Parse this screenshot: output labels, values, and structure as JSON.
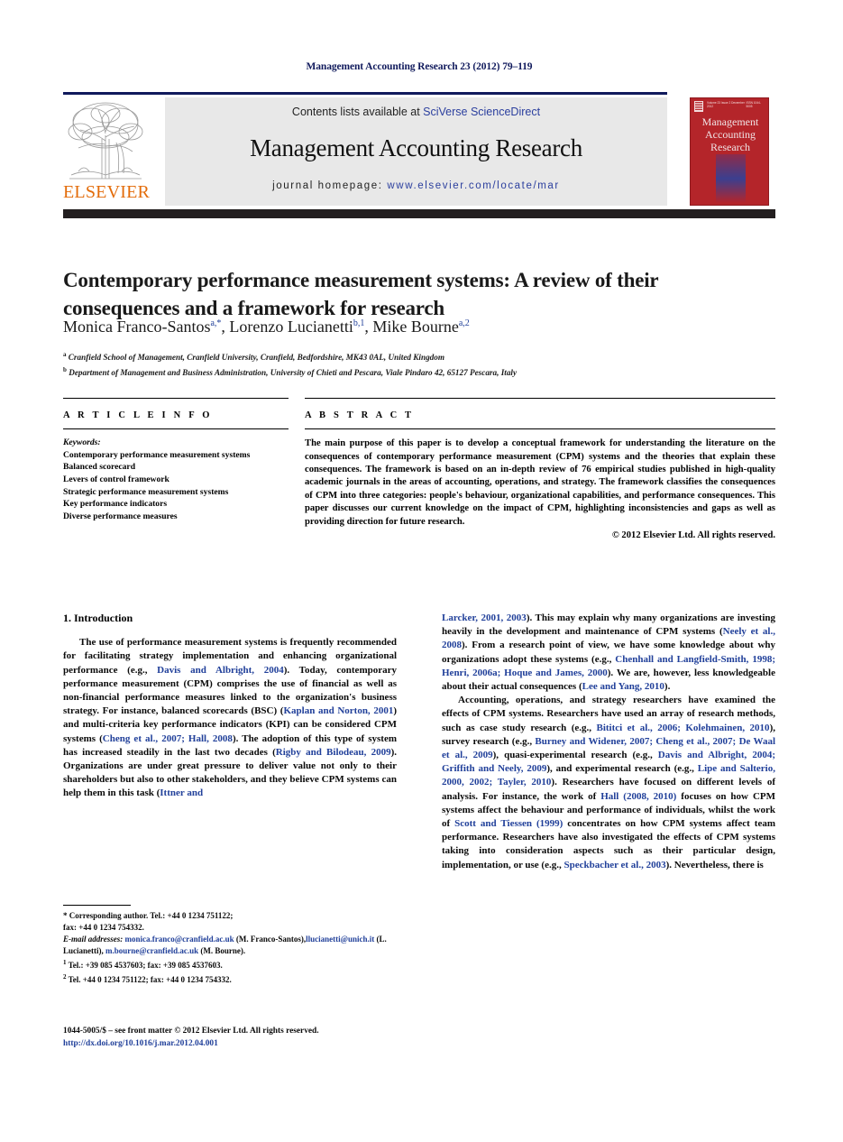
{
  "running_head": "Management Accounting Research 23 (2012) 79–119",
  "masthead": {
    "contents_prefix": "Contents lists available at ",
    "sciencedirect": "SciVerse ScienceDirect",
    "journal_title": "Management Accounting Research",
    "homepage_prefix": "journal homepage: ",
    "homepage_url": "www.elsevier.com/locate/mar",
    "publisher_logo_text": "ELSEVIER",
    "logo_icon": "elsevier-tree-icon",
    "accent_blue": "#2b3f9e",
    "logo_orange": "#e36c0a",
    "band_color": "#231f20"
  },
  "cover": {
    "title_line1": "Management",
    "title_line2": "Accounting",
    "title_line3": "Research",
    "meta_left": "Volume 23 Issue 2 December 2012",
    "meta_right": "ISSN 1044-5005",
    "color": "#b4252a"
  },
  "article": {
    "title": "Contemporary performance measurement systems: A review of their consequences and a framework for research",
    "authors": [
      {
        "name": "Monica Franco-Santos",
        "marks": "a,*"
      },
      {
        "name": "Lorenzo Lucianetti",
        "marks": "b,1"
      },
      {
        "name": "Mike Bourne",
        "marks": "a,2"
      }
    ],
    "affiliations": [
      {
        "mark": "a",
        "text": "Cranfield School of Management, Cranfield University, Cranfield, Bedfordshire, MK43 0AL, United Kingdom"
      },
      {
        "mark": "b",
        "text": "Department of Management and Business Administration, University of Chieti and Pescara, Viale Pindaro 42, 65127 Pescara, Italy"
      }
    ]
  },
  "article_info": {
    "heading": "A R T I C L E    I N F O",
    "keywords_label": "Keywords:",
    "keywords": [
      "Contemporary performance measurement systems",
      "Balanced scorecard",
      "Levers of control framework",
      "Strategic performance measurement systems",
      "Key performance indicators",
      "Diverse performance measures"
    ]
  },
  "abstract": {
    "heading": "A B S T R A C T",
    "text": "The main purpose of this paper is to develop a conceptual framework for understanding the literature on the consequences of contemporary performance measurement (CPM) systems and the theories that explain these consequences. The framework is based on an in-depth review of 76 empirical studies published in high-quality academic journals in the areas of accounting, operations, and strategy. The framework classifies the consequences of CPM into three categories: people's behaviour, organizational capabilities, and performance consequences. This paper discusses our current knowledge on the impact of CPM, highlighting inconsistencies and gaps as well as providing direction for future research.",
    "copyright": "© 2012 Elsevier Ltd. All rights reserved."
  },
  "body": {
    "section_heading": "1.  Introduction",
    "left_paragraphs": [
      {
        "parts": [
          {
            "t": "The use of performance measurement systems is frequently recommended for facilitating strategy implementation and enhancing organizational performance (e.g., "
          },
          {
            "t": "Davis and Albright, 2004",
            "ref": true
          },
          {
            "t": "). Today, contemporary performance measurement (CPM) comprises the use of financial as well as non-financial performance measures linked to the organization's business strategy. For instance, balanced scorecards (BSC) ("
          },
          {
            "t": "Kaplan and Norton, 2001",
            "ref": true
          },
          {
            "t": ") and multi-criteria key performance indicators (KPI) can be considered CPM systems ("
          },
          {
            "t": "Cheng et al., 2007; Hall, 2008",
            "ref": true
          },
          {
            "t": "). The adoption of this type of system has increased steadily in the last two decades ("
          },
          {
            "t": "Rigby and Bilodeau, 2009",
            "ref": true
          },
          {
            "t": "). Organizations are under great pressure to deliver value not only to their shareholders but also to other stakeholders, and they believe CPM systems can help them in this task ("
          },
          {
            "t": "Ittner and",
            "ref": true
          }
        ]
      }
    ],
    "right_paragraphs": [
      {
        "indent": false,
        "parts": [
          {
            "t": "Larcker, 2001, 2003",
            "ref": true
          },
          {
            "t": "). This may explain why many organizations are investing heavily in the development and maintenance of CPM systems ("
          },
          {
            "t": "Neely et al., 2008",
            "ref": true
          },
          {
            "t": "). From a research point of view, we have some knowledge about why organizations adopt these systems (e.g., "
          },
          {
            "t": "Chenhall and Langfield-Smith, 1998; Henri, 2006a; Hoque and James, 2000",
            "ref": true
          },
          {
            "t": "). We are, however, less knowledgeable about their actual consequences ("
          },
          {
            "t": "Lee and Yang, 2010",
            "ref": true
          },
          {
            "t": ")."
          }
        ]
      },
      {
        "indent": true,
        "parts": [
          {
            "t": "Accounting, operations, and strategy researchers have examined the effects of CPM systems. Researchers have used an array of research methods, such as case study research (e.g., "
          },
          {
            "t": "Bititci et al., 2006; Kolehmainen, 2010",
            "ref": true
          },
          {
            "t": "), survey research (e.g., "
          },
          {
            "t": "Burney and Widener, 2007; Cheng et al., 2007; De Waal et al., 2009",
            "ref": true
          },
          {
            "t": "), quasi-experimental research (e.g., "
          },
          {
            "t": "Davis and Albright, 2004; Griffith and Neely, 2009",
            "ref": true
          },
          {
            "t": "), and experimental research (e.g., "
          },
          {
            "t": "Lipe and Salterio, 2000, 2002; Tayler, 2010",
            "ref": true
          },
          {
            "t": "). Researchers have focused on different levels of analysis. For instance, the work of "
          },
          {
            "t": "Hall (2008, 2010)",
            "ref": true
          },
          {
            "t": " focuses on how CPM systems affect the behaviour and performance of individuals, whilst the work of "
          },
          {
            "t": "Scott and Tiessen (1999)",
            "ref": true
          },
          {
            "t": " concentrates on how CPM systems affect team performance. Researchers have also investigated the effects of CPM systems taking into consideration aspects such as their particular design, implementation, or use (e.g., "
          },
          {
            "t": "Speckbacher et al., 2003",
            "ref": true
          },
          {
            "t": "). Nevertheless, there is"
          }
        ]
      }
    ]
  },
  "footnotes": {
    "corresponding": "*  Corresponding author. Tel.: +44 0 1234 751122;",
    "corresponding_cont": "fax: +44 0 1234 754332.",
    "email_label": "E-mail addresses:",
    "emails": [
      {
        "addr": "monica.franco@cranfield.ac.uk",
        "who": " (M. Franco-Santos),"
      },
      {
        "addr": "llucianetti@unich.it",
        "who": " (L. Lucianetti), "
      },
      {
        "addr": "m.bourne@cranfield.ac.uk",
        "who": " (M. Bourne)."
      }
    ],
    "note1_mark": "1",
    "note1": "Tel.: +39 085 4537603; fax: +39 085 4537603.",
    "note2_mark": "2",
    "note2": "Tel. +44 0 1234 751122; fax: +44 0 1234 754332."
  },
  "imprint": {
    "line1": "1044-5005/$ – see front matter © 2012 Elsevier Ltd. All rights reserved.",
    "doi": "http://dx.doi.org/10.1016/j.mar.2012.04.001"
  }
}
